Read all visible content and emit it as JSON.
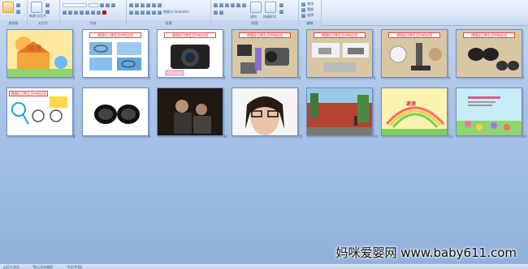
{
  "ribbon": {
    "groups": [
      {
        "label": "剪贴板"
      },
      {
        "label": "幻灯片"
      },
      {
        "label": "字体"
      },
      {
        "label": "段落"
      },
      {
        "label": "绘图"
      },
      {
        "label": "编辑"
      }
    ],
    "new_slide_label": "新建\n幻灯片",
    "find_label": "查找",
    "replace_label": "替换",
    "select_label": "选择",
    "arrange_label": "排列",
    "quick_styles_label": "快速样式",
    "smartart_label": "转换为 SmartArt"
  },
  "slides": [
    {
      "num": "1",
      "title": ""
    },
    {
      "num": "2",
      "title": "透镜在日常生活中的应用"
    },
    {
      "num": "3",
      "title": "透镜在日常生活中的应用"
    },
    {
      "num": "4",
      "title": "透镜在日常生活中的应用"
    },
    {
      "num": "5",
      "title": "透镜在日常生活中的应用"
    },
    {
      "num": "6",
      "title": "透镜在日常生活中的应用"
    },
    {
      "num": "7",
      "title": "透镜在日常生活中的应用"
    },
    {
      "num": "8",
      "title": "透镜在日常生活中的应用"
    },
    {
      "num": "9",
      "title": ""
    },
    {
      "num": "10",
      "title": ""
    },
    {
      "num": "11",
      "title": ""
    },
    {
      "num": "12",
      "title": ""
    },
    {
      "num": "13",
      "title": "谢谢"
    },
    {
      "num": "14",
      "title": ""
    }
  ],
  "status": {
    "view": "幻灯片浏览",
    "theme": "\"默认设计模板\"",
    "lang": "中文(中国)"
  },
  "watermark": "妈咪爱婴网 www.baby611.com"
}
